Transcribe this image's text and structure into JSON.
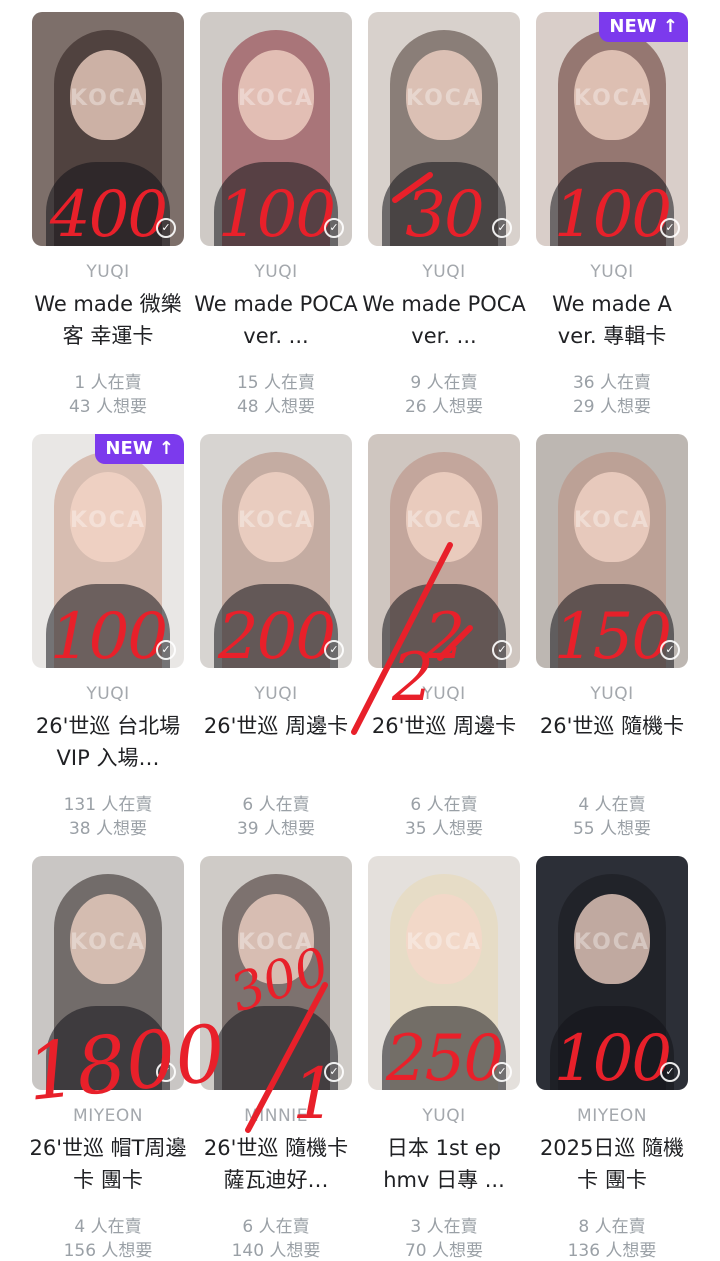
{
  "badge_text": "NEW ↑",
  "watermark": "KOCA",
  "cards": [
    {
      "member": "YUQI",
      "title": "We made 微樂客 幸運卡",
      "sellers": "1 人在賣",
      "wanters": "43 人想要",
      "price": "400",
      "new": false,
      "bg": "#7d6f6a",
      "hair": "#2b1d1c"
    },
    {
      "member": "YUQI",
      "title": "We made POCA ver. ...",
      "sellers": "15 人在賣",
      "wanters": "48 人想要",
      "price": "100",
      "new": false,
      "bg": "#cfcac6",
      "hair": "#8a2f3b"
    },
    {
      "member": "YUQI",
      "title": "We made POCA ver. ...",
      "sellers": "9 人在賣",
      "wanters": "26 人想要",
      "price": "30",
      "new": false,
      "bg": "#d8d1cc",
      "hair": "#4a3a33"
    },
    {
      "member": "YUQI",
      "title": "We made A ver. 專輯卡",
      "sellers": "36 人在賣",
      "wanters": "29 人想要",
      "price": "100",
      "new": true,
      "bg": "#d9cec9",
      "hair": "#5c2f28"
    },
    {
      "member": "YUQI",
      "title": "26'世巡 台北場VIP 入場…",
      "sellers": "131 人在賣",
      "wanters": "38 人想要",
      "price": "100",
      "new": true,
      "bg": "#e9e7e5",
      "hair": "#c89a86"
    },
    {
      "member": "YUQI",
      "title": "26'世巡 周邊卡",
      "sellers": "6 人在賣",
      "wanters": "39 人想要",
      "price": "200",
      "new": false,
      "bg": "#d7d4d1",
      "hair": "#b58b7c"
    },
    {
      "member": "YUQI",
      "title": "26'世巡 周邊卡",
      "sellers": "6 人在賣",
      "wanters": "35 人想要",
      "price": "2",
      "new": false,
      "bg": "#cfc6c0",
      "hair": "#b98d7e"
    },
    {
      "member": "YUQI",
      "title": "26'世巡 隨機卡",
      "sellers": "4 人在賣",
      "wanters": "55 人想要",
      "price": "150",
      "new": false,
      "bg": "#bdb7b2",
      "hair": "#bb8f80"
    },
    {
      "member": "MIYEON",
      "title": "26'世巡 帽T周邊卡 團卡",
      "sellers": "4 人在賣",
      "wanters": "156 人想要",
      "price": "",
      "new": false,
      "bg": "#c9c6c4",
      "hair": "#2a2221"
    },
    {
      "member": "MINNIE",
      "title": "26'世巡 隨機卡 薩瓦迪好…",
      "sellers": "6 人在賣",
      "wanters": "140 人想要",
      "price": "",
      "new": false,
      "bg": "#cfcbc7",
      "hair": "#3a2a26"
    },
    {
      "member": "YUQI",
      "title": "日本 1st ep hmv 日專 ...",
      "sellers": "3 人在賣",
      "wanters": "70 人想要",
      "price": "250",
      "new": false,
      "bg": "#e4e0dc",
      "hair": "#e7d9b5"
    },
    {
      "member": "MIYEON",
      "title": "2025日巡 隨機卡 團卡",
      "sellers": "8 人在賣",
      "wanters": "136 人想要",
      "price": "100",
      "new": false,
      "bg": "#2c2f37",
      "hair": "#1a1a1f"
    }
  ],
  "handwritten": {
    "note_300": "300",
    "note_1800": "1800",
    "note_1": "1",
    "note_2": "2"
  }
}
